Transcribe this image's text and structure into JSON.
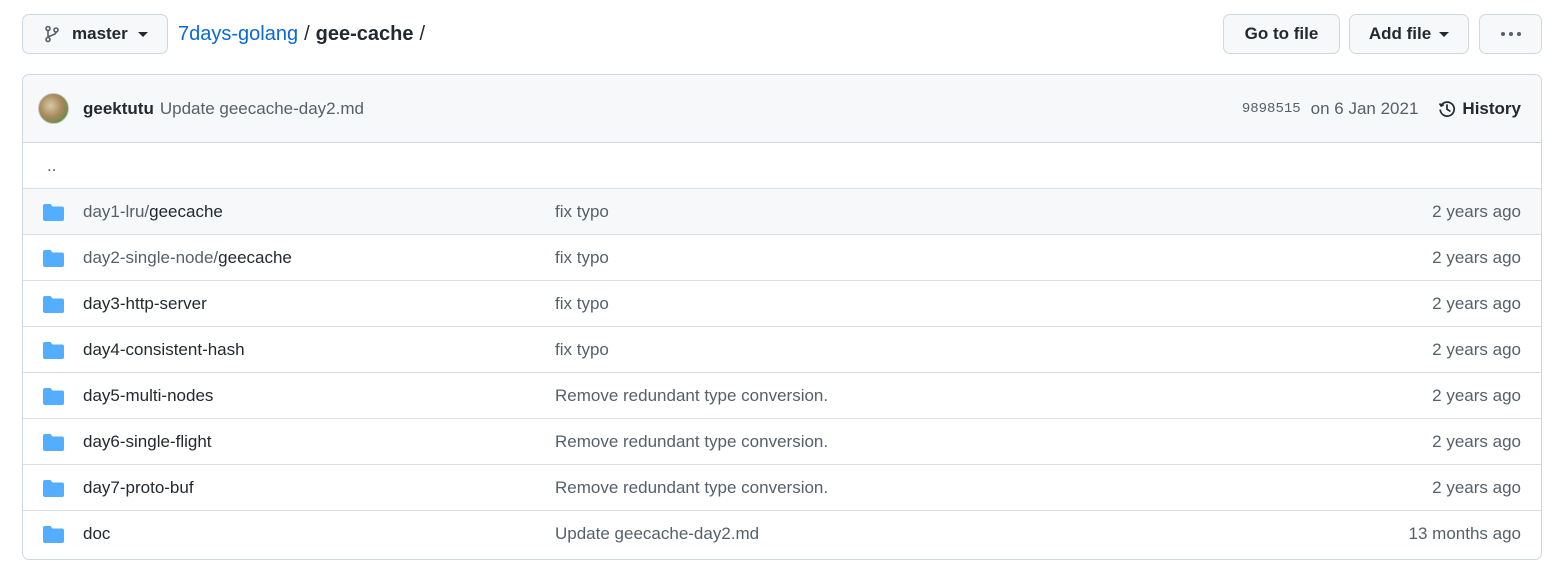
{
  "header": {
    "branch": "master",
    "repo": "7days-golang",
    "separator": "/",
    "dir": "gee-cache",
    "go_to_file": "Go to file",
    "add_file": "Add file"
  },
  "commit": {
    "author": "geektutu",
    "message": "Update geecache-day2.md",
    "sha": "9898515",
    "date": "on 6 Jan 2021",
    "history_label": "History"
  },
  "files": {
    "parent": "..",
    "rows": [
      {
        "prefix": "day1-lru/",
        "name": "geecache",
        "message": "fix typo",
        "age": "2 years ago"
      },
      {
        "prefix": "day2-single-node/",
        "name": "geecache",
        "message": "fix typo",
        "age": "2 years ago"
      },
      {
        "prefix": "",
        "name": "day3-http-server",
        "message": "fix typo",
        "age": "2 years ago"
      },
      {
        "prefix": "",
        "name": "day4-consistent-hash",
        "message": "fix typo",
        "age": "2 years ago"
      },
      {
        "prefix": "",
        "name": "day5-multi-nodes",
        "message": "Remove redundant type conversion.",
        "age": "2 years ago"
      },
      {
        "prefix": "",
        "name": "day6-single-flight",
        "message": "Remove redundant type conversion.",
        "age": "2 years ago"
      },
      {
        "prefix": "",
        "name": "day7-proto-buf",
        "message": "Remove redundant type conversion.",
        "age": "2 years ago"
      },
      {
        "prefix": "",
        "name": "doc",
        "message": "Update geecache-day2.md",
        "age": "13 months ago"
      }
    ]
  },
  "icons": {
    "branch": "git-branch-icon",
    "folder": "folder-icon",
    "history": "clock-history-icon",
    "more": "kebab-horizontal-icon"
  },
  "colors": {
    "link": "#0969da",
    "folder": "#54aeff",
    "muted": "#57606a"
  }
}
